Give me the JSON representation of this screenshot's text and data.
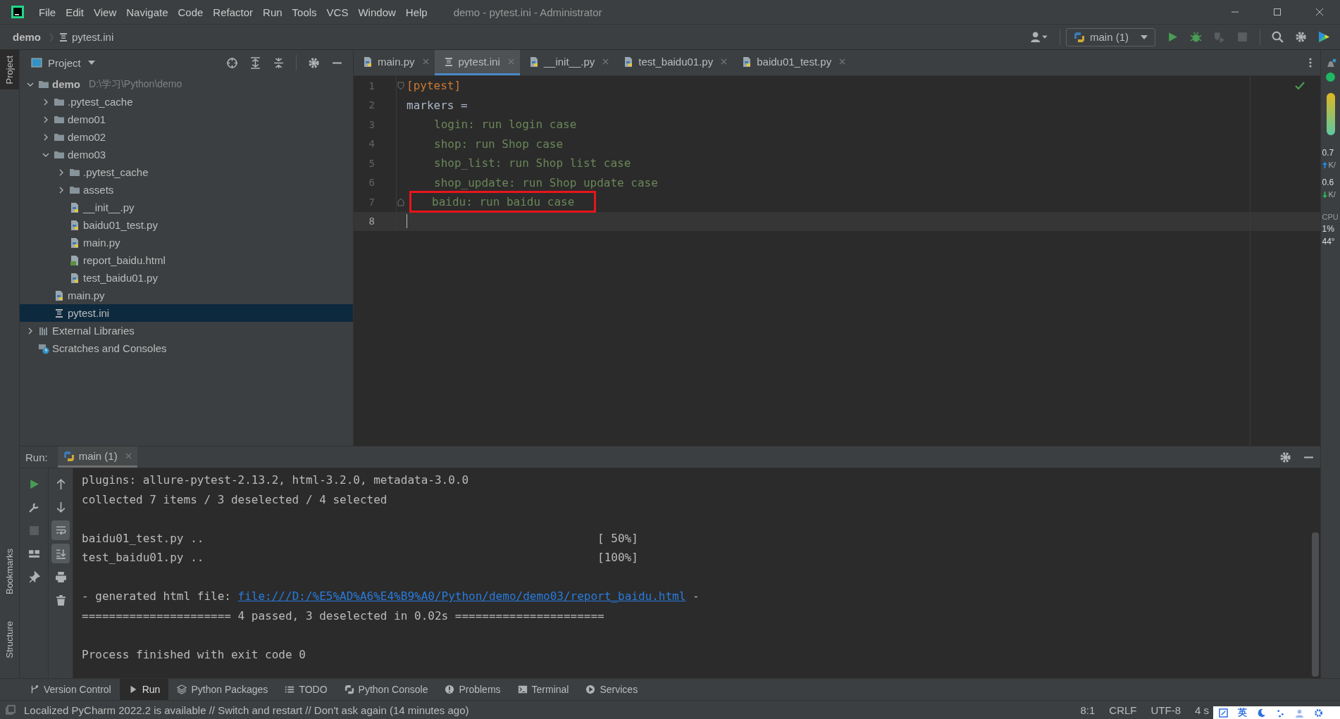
{
  "window": {
    "title": "demo - pytest.ini - Administrator"
  },
  "menu": [
    "File",
    "Edit",
    "View",
    "Navigate",
    "Code",
    "Refactor",
    "Run",
    "Tools",
    "VCS",
    "Window",
    "Help"
  ],
  "breadcrumbs": [
    {
      "label": "demo",
      "kind": "project"
    },
    {
      "label": "pytest.ini",
      "kind": "ini"
    }
  ],
  "run_config": {
    "label": "main (1)"
  },
  "toolbar_actions": [
    {
      "kind": "run",
      "disabled": false
    },
    {
      "kind": "debug",
      "disabled": false
    },
    {
      "kind": "coverage",
      "disabled": true
    },
    {
      "kind": "stop",
      "disabled": true
    }
  ],
  "side_tabs": [
    {
      "label": "Project",
      "selected": true
    },
    {
      "label": "Bookmarks",
      "selected": false
    },
    {
      "label": "Structure",
      "selected": false
    }
  ],
  "project_panel": {
    "title": "Project",
    "tree": [
      {
        "name": "demo",
        "hint": "D:\\学习\\Python\\demo",
        "kind": "folder",
        "expanded": true,
        "selected": false,
        "children": [
          {
            "name": ".pytest_cache",
            "kind": "folder",
            "expanded": false,
            "selected": false
          },
          {
            "name": "demo01",
            "kind": "folder",
            "expanded": false,
            "selected": false
          },
          {
            "name": "demo02",
            "kind": "folder",
            "expanded": false,
            "selected": false
          },
          {
            "name": "demo03",
            "kind": "folder",
            "expanded": true,
            "selected": false,
            "children": [
              {
                "name": ".pytest_cache",
                "kind": "folder",
                "expanded": false,
                "selected": false
              },
              {
                "name": "assets",
                "kind": "folder",
                "expanded": false,
                "selected": false
              },
              {
                "name": "__init__.py",
                "kind": "python",
                "selected": false
              },
              {
                "name": "baidu01_test.py",
                "kind": "python",
                "selected": false
              },
              {
                "name": "main.py",
                "kind": "python",
                "selected": false
              },
              {
                "name": "report_baidu.html",
                "kind": "html",
                "selected": false
              },
              {
                "name": "test_baidu01.py",
                "kind": "python",
                "selected": false
              }
            ]
          },
          {
            "name": "main.py",
            "kind": "python",
            "selected": false
          },
          {
            "name": "pytest.ini",
            "kind": "ini",
            "selected": true
          }
        ]
      },
      {
        "name": "External Libraries",
        "kind": "libraries",
        "expanded": false,
        "selected": false
      },
      {
        "name": "Scratches and Consoles",
        "kind": "scratches",
        "selected": false
      }
    ]
  },
  "editor": {
    "tabs": [
      {
        "label": "main.py",
        "kind": "python",
        "selected": false
      },
      {
        "label": "pytest.ini",
        "kind": "ini",
        "selected": true
      },
      {
        "label": "__init__.py",
        "kind": "python",
        "selected": false
      },
      {
        "label": "test_baidu01.py",
        "kind": "python",
        "selected": false
      },
      {
        "label": "baidu01_test.py",
        "kind": "python",
        "selected": false
      }
    ],
    "lines": [
      {
        "number": "1",
        "text": "[pytest]",
        "kind": "section",
        "indented": false,
        "fold_start": true,
        "fold_end": false,
        "current": false
      },
      {
        "number": "2",
        "text": "markers =",
        "kind": "key",
        "indented": false,
        "fold_start": false,
        "fold_end": false,
        "current": false
      },
      {
        "number": "3",
        "text": "login: run login case",
        "kind": "value",
        "indented": true,
        "fold_start": false,
        "fold_end": false,
        "current": false
      },
      {
        "number": "4",
        "text": "shop: run Shop case",
        "kind": "value",
        "indented": true,
        "fold_start": false,
        "fold_end": false,
        "current": false
      },
      {
        "number": "5",
        "text": "shop_list: run Shop list case",
        "kind": "value",
        "indented": true,
        "fold_start": false,
        "fold_end": false,
        "current": false
      },
      {
        "number": "6",
        "text": "shop_update: run Shop update case",
        "kind": "value",
        "indented": true,
        "fold_start": false,
        "fold_end": false,
        "current": false
      },
      {
        "number": "7",
        "text": "baidu: run baidu case",
        "kind": "value",
        "indented": true,
        "fold_start": false,
        "fold_end": true,
        "current": false,
        "annotated": true
      },
      {
        "number": "8",
        "fold_start": false,
        "fold_end": false,
        "current": true
      }
    ]
  },
  "run_panel": {
    "label": "Run:",
    "tabs": [
      {
        "label": "main (1)",
        "selected": true
      }
    ],
    "left_actions": [
      {
        "kind": "rerun",
        "disabled": false
      },
      {
        "kind": "wrench",
        "disabled": false
      },
      {
        "kind": "stop",
        "disabled": true
      },
      {
        "kind": "layout",
        "disabled": false
      },
      {
        "kind": "pin",
        "disabled": false
      }
    ],
    "right_actions": [
      {
        "kind": "up",
        "on": false
      },
      {
        "kind": "down",
        "on": false
      },
      {
        "kind": "wrap",
        "on": true
      },
      {
        "kind": "scroll-end",
        "on": true
      },
      {
        "kind": "print",
        "on": false
      },
      {
        "kind": "trash",
        "on": false
      }
    ],
    "console": [
      {
        "kind": "text",
        "text": "plugins: allure-pytest-2.13.2, html-3.2.0, metadata-3.0.0"
      },
      {
        "kind": "text",
        "text": "collected 7 items / 3 deselected / 4 selected"
      },
      {
        "kind": "blank"
      },
      {
        "kind": "progress",
        "text": "baidu01_test.py ..",
        "percent": "[ 50%]"
      },
      {
        "kind": "progress",
        "text": "test_baidu01.py ..",
        "percent": "[100%]"
      },
      {
        "kind": "blank"
      },
      {
        "kind": "link",
        "before": "- generated html file: ",
        "link": "file:///D:/%E5%AD%A6%E4%B9%A0/Python/demo/demo03/report_baidu.html",
        "after": " -"
      },
      {
        "kind": "text",
        "text": "====================== 4 passed, 3 deselected in 0.02s ======================"
      },
      {
        "kind": "blank"
      },
      {
        "kind": "text",
        "text": "Process finished with exit code 0"
      }
    ]
  },
  "tool_tabs": [
    {
      "label": "Version Control",
      "kind": "vcs",
      "selected": false
    },
    {
      "label": "Run",
      "kind": "run",
      "selected": true
    },
    {
      "label": "Python Packages",
      "kind": "packages",
      "selected": false
    },
    {
      "label": "TODO",
      "kind": "todo",
      "selected": false
    },
    {
      "label": "Python Console",
      "kind": "python",
      "selected": false
    },
    {
      "label": "Problems",
      "kind": "problems",
      "selected": false
    },
    {
      "label": "Terminal",
      "kind": "terminal",
      "selected": false
    },
    {
      "label": "Services",
      "kind": "services",
      "selected": false
    }
  ],
  "status_bar": {
    "message": "Localized PyCharm 2022.2 is available // Switch and restart // Don't ask again (14 minutes ago)",
    "items": [
      "8:1",
      "CRLF",
      "UTF-8",
      "4 s"
    ]
  },
  "system_monitor": {
    "upload": "0.7",
    "upload_unit": "K/",
    "download": "0.6",
    "download_unit": "K/",
    "cpu_label": "CPU",
    "cpu": "1%",
    "temperature": "44°"
  },
  "ime_bar": {
    "language": "英"
  }
}
